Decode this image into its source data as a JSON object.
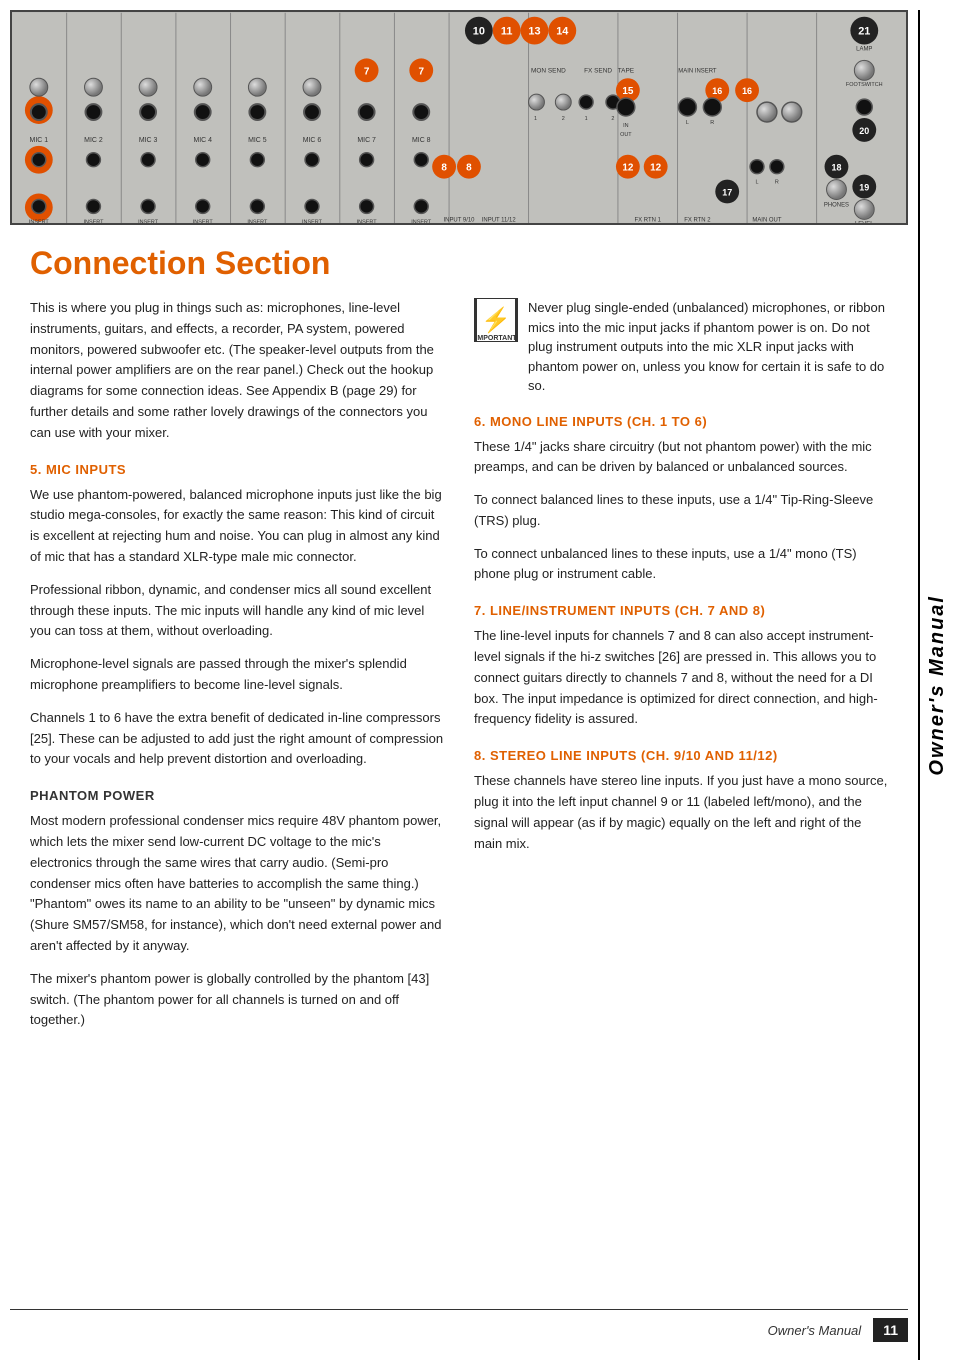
{
  "sidebar": {
    "text": "Owner's Manual"
  },
  "header": {
    "diagram_alt": "Mixer connection panel diagram"
  },
  "page": {
    "title": "Connection Section",
    "footer_label": "Owner's Manual",
    "page_number": "11"
  },
  "intro": {
    "text": "This is where you plug in things such as: microphones, line-level instruments, guitars, and effects, a recorder, PA system, powered monitors, powered subwoofer etc. (The speaker-level outputs from the internal power amplifiers are on the rear panel.) Check out the hookup diagrams for some connection ideas. See Appendix B (page 29) for further details and some rather lovely drawings of the connectors you can use with your mixer."
  },
  "warning": {
    "icon": "⚡",
    "text": "Never plug single-ended (unbalanced) microphones, or ribbon mics into the mic input jacks if phantom power is on.  Do not plug instrument outputs into the mic XLR input jacks with phantom power on, unless you know for certain it is safe to do so."
  },
  "sections": {
    "mic_inputs": {
      "heading": "5. MIC INPUTS",
      "paragraphs": [
        "We use phantom-powered, balanced microphone inputs just like the big studio mega-consoles, for exactly the same reason: This kind of circuit is excellent at rejecting hum and noise. You can plug in almost any kind of mic that has a standard XLR-type male mic connector.",
        "Professional ribbon, dynamic, and condenser mics all sound excellent through these inputs. The mic inputs will handle any kind of mic level you can toss at them, without overloading.",
        "Microphone-level signals are passed through the mixer's splendid microphone preamplifiers to become line-level signals.",
        "Channels 1 to 6 have the extra benefit of dedicated in-line compressors [25]. These can be adjusted to add just the right amount of compression to your vocals and help prevent distortion and overloading."
      ]
    },
    "phantom_power": {
      "heading": "PHANTOM POWER",
      "paragraphs": [
        "Most modern professional condenser mics require 48V phantom power, which lets the mixer send low-current DC voltage to the mic's electronics through the same wires that carry audio. (Semi-pro condenser mics often have batteries to accomplish the same thing.) \"Phantom\" owes its name to an ability to be \"unseen\" by dynamic mics (Shure SM57/SM58, for instance), which don't need external power and aren't affected by it anyway.",
        "The mixer's phantom power is globally controlled by the phantom [43] switch. (The phantom power for all channels is turned on and off together.)"
      ]
    },
    "mono_line": {
      "heading": "6. MONO LINE INPUTS (Ch. 1 to 6)",
      "paragraphs": [
        "These 1/4\" jacks share circuitry (but not phantom power) with the mic preamps, and can be driven by balanced or unbalanced sources.",
        "To connect balanced lines to these inputs, use a 1/4\" Tip-Ring-Sleeve (TRS) plug.",
        "To connect unbalanced lines to these inputs, use a 1/4\" mono (TS) phone plug or instrument cable."
      ]
    },
    "line_instrument": {
      "heading": "7. LINE/INSTRUMENT INPUTS (Ch. 7 and 8)",
      "paragraphs": [
        "The line-level inputs for channels 7 and 8 can also accept instrument-level signals if the hi-z switches [26] are pressed in. This allows you to connect guitars directly to channels 7 and 8, without the need for a DI box. The input impedance is optimized for direct connection, and high-frequency fidelity is assured."
      ]
    },
    "stereo_line": {
      "heading": "8. STEREO LINE INPUTS (Ch. 9/10 and 11/12)",
      "paragraphs": [
        "These channels have stereo line inputs. If you just have a mono source, plug it into the left input channel 9 or 11 (labeled left/mono), and the signal will appear (as if by magic) equally on the left and right of the main mix."
      ]
    }
  }
}
